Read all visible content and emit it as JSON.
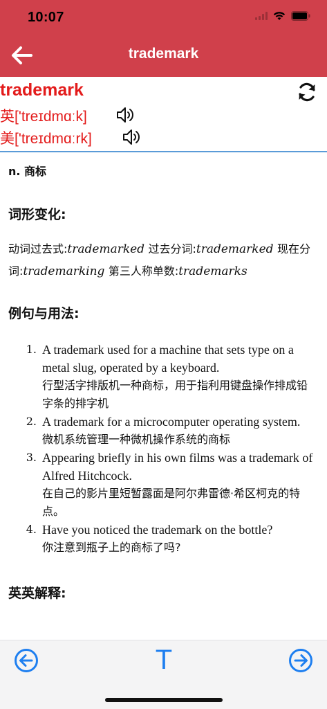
{
  "status_bar": {
    "time": "10:07"
  },
  "header": {
    "title": "trademark"
  },
  "word": {
    "headword": "trademark",
    "uk_phonetic": "英['treɪdmɑːk]",
    "us_phonetic": "美['treɪdmɑːrk]"
  },
  "definition": {
    "pos_line": "n. 商标"
  },
  "inflections": {
    "heading": "词形变化:",
    "past_label": "动词过去式:",
    "past_value": "trademarked",
    "pp_label": "过去分词:",
    "pp_value": "trademarked",
    "present_label": "现在分词:",
    "present_value": "trademarking",
    "third_label": "第三人称单数:",
    "third_value": "trademarks"
  },
  "examples": {
    "heading": "例句与用法:",
    "items": [
      {
        "num": "1.",
        "en": "A trademark used for a machine that sets type on a metal slug, operated by a keyboard.",
        "zh": "行型活字排版机一种商标，用于指利用键盘操作排成铅字条的排字机"
      },
      {
        "num": "2.",
        "en": "A trademark for a microcomputer operating system.",
        "zh": "微机系统管理一种微机操作系统的商标"
      },
      {
        "num": "3.",
        "en": "Appearing briefly in his own films was a trademark of Alfred Hitchcock.",
        "zh": "在自己的影片里短暂露面是阿尔弗雷德·希区柯克的特点。"
      },
      {
        "num": "4.",
        "en": "Have you noticed the trademark on the bottle?",
        "zh": "你注意到瓶子上的商标了吗?"
      }
    ]
  },
  "english_definition": {
    "heading": "英英解释:"
  },
  "toolbar": {
    "text_button_label": "T"
  },
  "colors": {
    "header_bg": "#d0404b",
    "word_red": "#e31b1b",
    "accent_blue": "#1e7ff0",
    "divider_blue": "#5a9bd8"
  }
}
